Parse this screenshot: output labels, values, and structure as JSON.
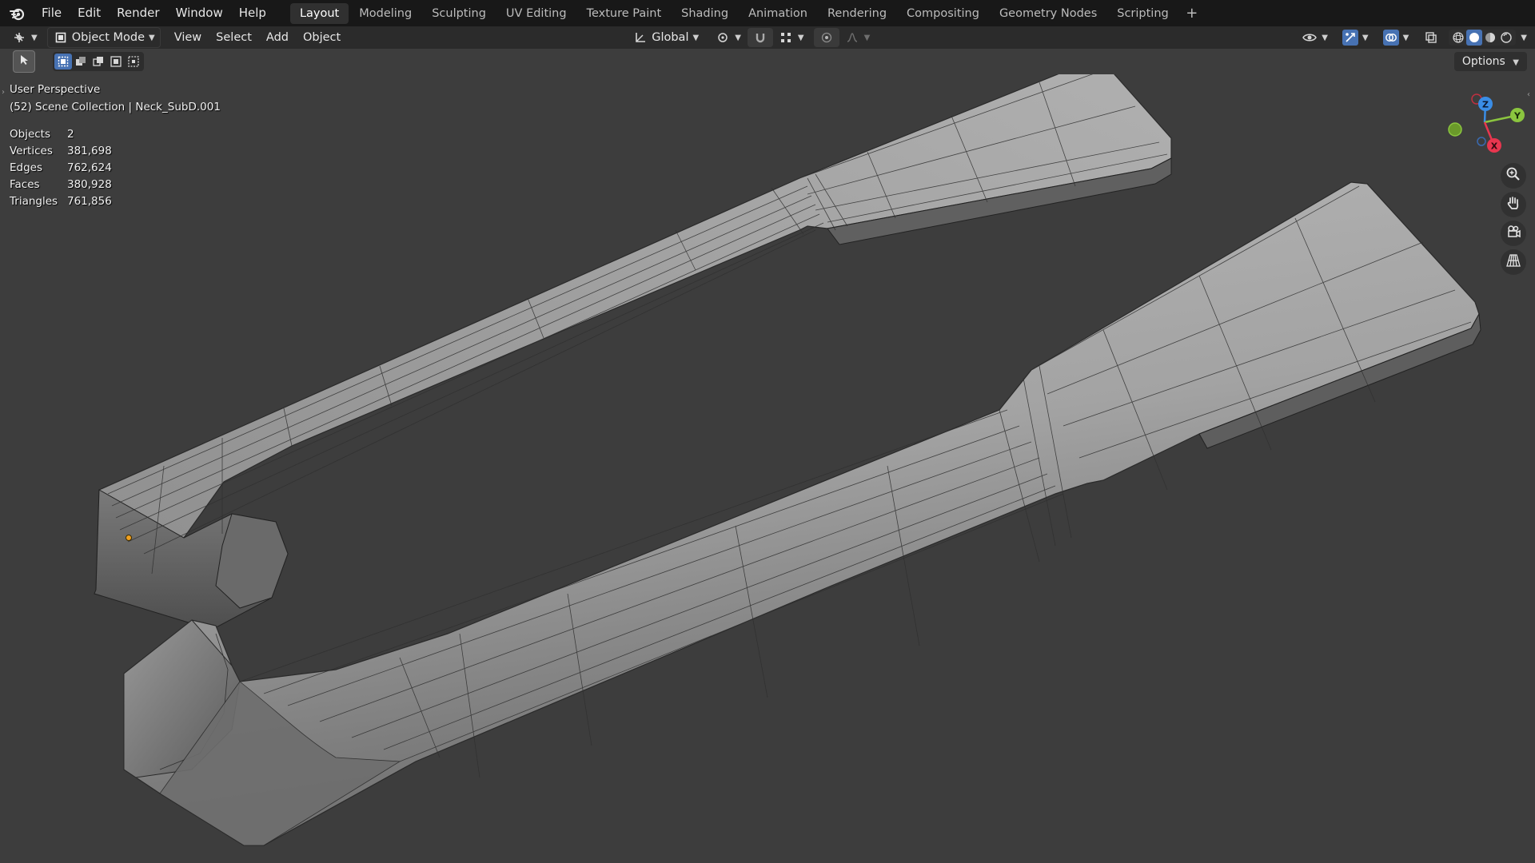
{
  "topbar": {
    "menus": [
      "File",
      "Edit",
      "Render",
      "Window",
      "Help"
    ],
    "workspaces": [
      "Layout",
      "Modeling",
      "Sculpting",
      "UV Editing",
      "Texture Paint",
      "Shading",
      "Animation",
      "Rendering",
      "Compositing",
      "Geometry Nodes",
      "Scripting"
    ],
    "active_workspace": "Layout",
    "add_label": "+"
  },
  "header": {
    "mode": "Object Mode",
    "menus": [
      "View",
      "Select",
      "Add",
      "Object"
    ],
    "transform_orientation": "Global"
  },
  "toolbar": {
    "options_label": "Options"
  },
  "viewport": {
    "view_name": "User Perspective",
    "collection_info": "(52) Scene Collection | Neck_SubD.001",
    "stats": [
      {
        "label": "Objects",
        "value": "2"
      },
      {
        "label": "Vertices",
        "value": "381,698"
      },
      {
        "label": "Edges",
        "value": "762,624"
      },
      {
        "label": "Faces",
        "value": "380,928"
      },
      {
        "label": "Triangles",
        "value": "761,856"
      }
    ]
  },
  "gizmo": {
    "z_label": "Z",
    "y_label": "Y",
    "x_label": "X",
    "colors": {
      "x": "#e8364f",
      "y": "#8bc53f",
      "z": "#3a8de6"
    }
  },
  "colors": {
    "accent": "#4772b3",
    "background": "#3d3d3d",
    "topbar": "#181818",
    "mesh": "#a8a8a8",
    "origin": "#f0a020"
  }
}
